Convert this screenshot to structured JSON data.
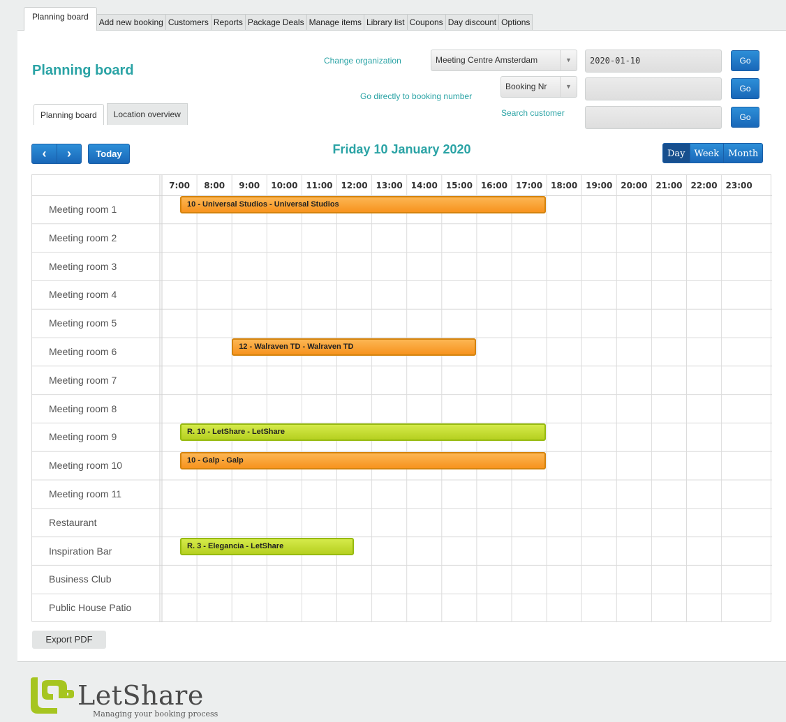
{
  "top_tabs": [
    "Planning board",
    "Add new booking",
    "Customers",
    "Reports",
    "Package Deals",
    "Manage items",
    "Library list",
    "Coupons",
    "Day discount",
    "Options"
  ],
  "page": {
    "title": "Planning board"
  },
  "sub_tabs": [
    "Planning board",
    "Location overview"
  ],
  "filters": {
    "change_org_label": "Change organization",
    "organization": "Meeting Centre Amsterdam",
    "date_value": "2020-01-10",
    "booking_label": "Go directly to booking number",
    "booking_select": "Booking Nr",
    "search_label": "Search customer",
    "go_label": "Go"
  },
  "nav": {
    "prev": "‹",
    "next": "›",
    "today": "Today",
    "date_title": "Friday 10 January 2020"
  },
  "views": [
    "Day",
    "Week",
    "Month"
  ],
  "active_view": "Day",
  "hours": [
    "7:00",
    "8:00",
    "9:00",
    "10:00",
    "11:00",
    "12:00",
    "13:00",
    "14:00",
    "15:00",
    "16:00",
    "17:00",
    "18:00",
    "19:00",
    "20:00",
    "21:00",
    "22:00",
    "23:00"
  ],
  "rooms": [
    "Meeting room 1",
    "Meeting room 2",
    "Meeting room 3",
    "Meeting room 4",
    "Meeting room 5",
    "Meeting room 6",
    "Meeting room 7",
    "Meeting room 8",
    "Meeting room 9",
    "Meeting room 10",
    "Meeting room 11",
    "Restaurant",
    "Inspiration Bar",
    "Business Club",
    "Public House Patio"
  ],
  "bookings": [
    {
      "room_index": 0,
      "label": "10 - Universal Studios - Universal Studios",
      "start_hour": 7.5,
      "end_hour": 18.0,
      "color": "orange"
    },
    {
      "room_index": 5,
      "label": "12 - Walraven TD - Walraven TD",
      "start_hour": 9.0,
      "end_hour": 16.0,
      "color": "orange"
    },
    {
      "room_index": 8,
      "label": "R. 10 - LetShare - LetShare",
      "start_hour": 7.5,
      "end_hour": 18.0,
      "color": "green"
    },
    {
      "room_index": 9,
      "label": "10 - Galp - Galp",
      "start_hour": 7.5,
      "end_hour": 18.0,
      "color": "orange"
    },
    {
      "room_index": 12,
      "label": "R. 3 - Elegancia - LetShare",
      "start_hour": 7.5,
      "end_hour": 12.5,
      "color": "green"
    }
  ],
  "colors": {
    "accent": "#2aa3a5",
    "button": "#1967b8",
    "orange": "#f7931e",
    "green": "#b6d020"
  },
  "export_label": "Export PDF",
  "logo": {
    "name": "LetShare",
    "tagline": "Managing your booking process"
  }
}
